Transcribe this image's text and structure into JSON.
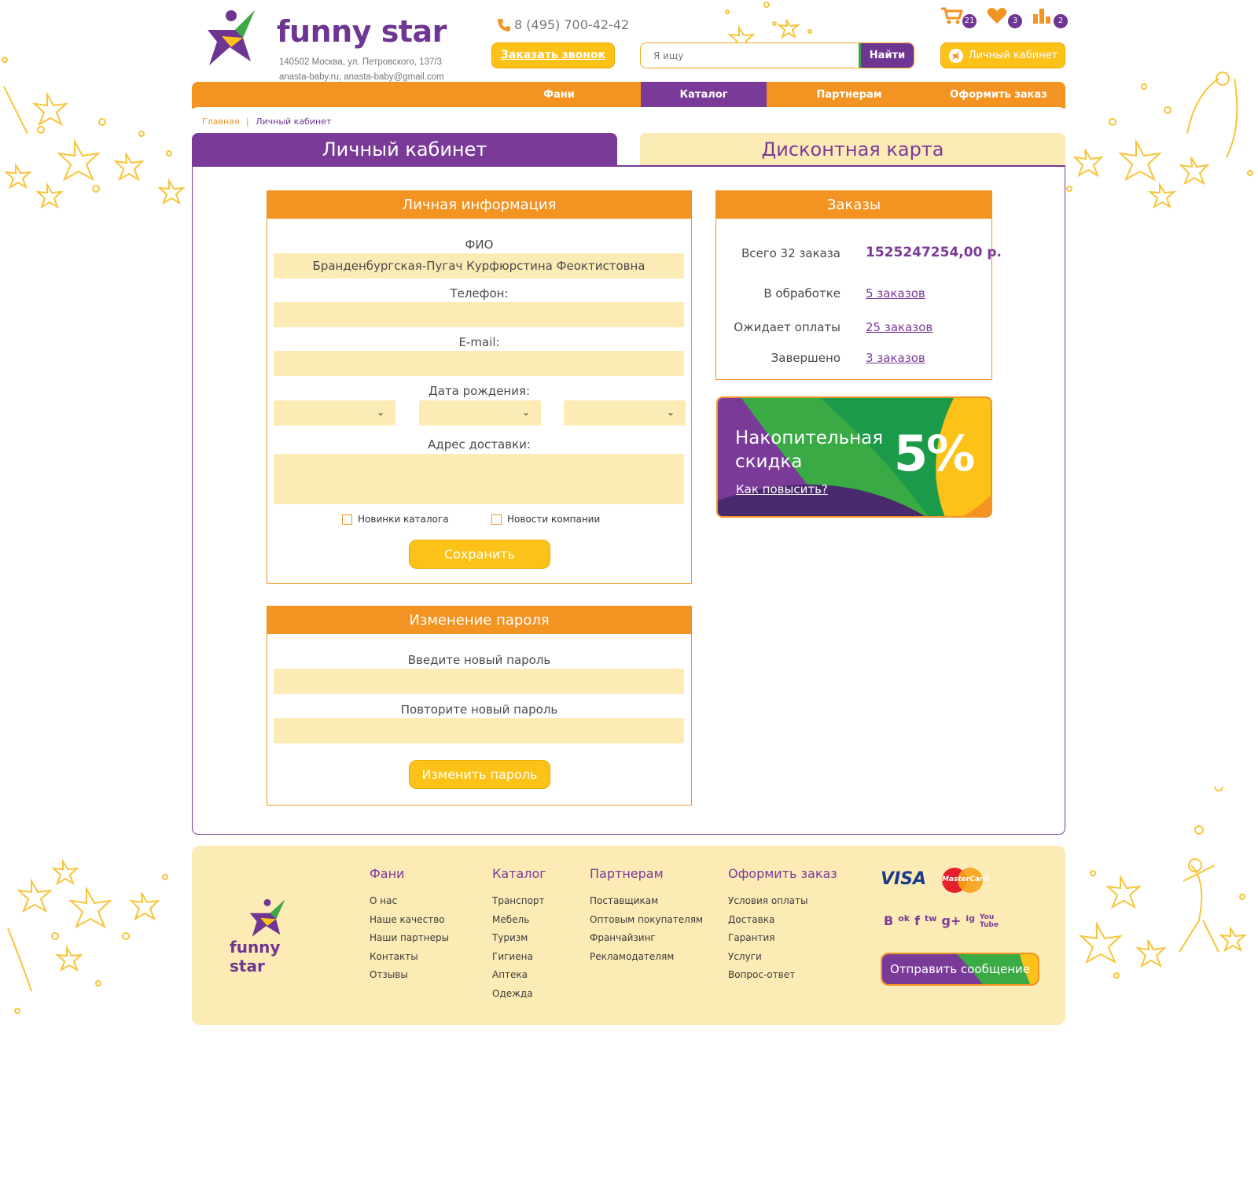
{
  "header": {
    "logo_text": "funny star",
    "address": "140502 Москва, ул. Петровского, 137/3",
    "emails": "anasta-baby.ru, anasta-baby@gmail.com",
    "phone": "8 (495) 700-42-42",
    "callback_label": "Заказать звонок",
    "search_placeholder": "Я ищу",
    "search_button": "Найти",
    "cabinet_label": "Личный кабинет",
    "counters": {
      "cart": "21",
      "favorites": "3",
      "compare": "2"
    }
  },
  "nav": {
    "items": [
      {
        "label": "Фани"
      },
      {
        "label": "Каталог"
      },
      {
        "label": "Партнерам"
      },
      {
        "label": "Оформить заказ"
      }
    ]
  },
  "breadcrumbs": {
    "home": "Главная",
    "sep": "|",
    "current": "Личный кабинет"
  },
  "tabs": {
    "cabinet": "Личный кабинет",
    "discount": "Дисконтная карта"
  },
  "personal": {
    "title": "Личная информация",
    "fio_label": "ФИО",
    "fio_value": "Бранденбургская-Пугач Курфюрстина Феоктистовна",
    "phone_label": "Телефон:",
    "email_label": "E-mail:",
    "birth_label": "Дата рождения:",
    "address_label": "Адрес доставки:",
    "check_news": "Новинки каталога",
    "check_company": "Новости компании",
    "save": "Сохранить"
  },
  "password": {
    "title": "Изменение пароля",
    "new_label": "Введите новый пароль",
    "repeat_label": "Повторите новый пароль",
    "button": "Изменить пароль"
  },
  "orders": {
    "title": "Заказы",
    "rows": [
      {
        "label": "Всего 32 заказа",
        "value": "1525247254,00 р."
      },
      {
        "label": "В обработке",
        "value": "5 заказов"
      },
      {
        "label": "Ожидает оплаты",
        "value": "25 заказов"
      },
      {
        "label": "Завершено",
        "value": "3 заказов"
      }
    ]
  },
  "discount_card": {
    "title_line1": "Накопительная",
    "title_line2": "скидка",
    "percent": "5%",
    "link": "Как повысить?"
  },
  "footer": {
    "logo_text": "funny star",
    "columns": [
      {
        "title": "Фани",
        "links": [
          "О нас",
          "Наше качество",
          "Наши партнеры",
          "Контакты",
          "Отзывы"
        ]
      },
      {
        "title": "Каталог",
        "links": [
          "Транспорт",
          "Мебель",
          "Туризм",
          "Гигиена",
          "Аптека",
          "Одежда"
        ]
      },
      {
        "title": "Партнерам",
        "links": [
          "Поставщикам",
          "Оптовым покупателям",
          "Франчайзинг",
          "Рекламодателям"
        ]
      },
      {
        "title": "Оформить заказ",
        "links": [
          "Условия оплаты",
          "Доставка",
          "Гарантия",
          "Услуги",
          "Вопрос-ответ"
        ]
      }
    ],
    "visa": "VISA",
    "mastercard": "MasterCard",
    "social": [
      "B",
      "ok",
      "f",
      "tw",
      "g+",
      "ig",
      "You Tube"
    ],
    "send_button": "Отправить сообщение"
  },
  "colors": {
    "orange": "#f39322",
    "purple": "#7a3a98",
    "yellow": "#fdc218",
    "cream": "#fdebb6",
    "green": "#3aaa45"
  }
}
